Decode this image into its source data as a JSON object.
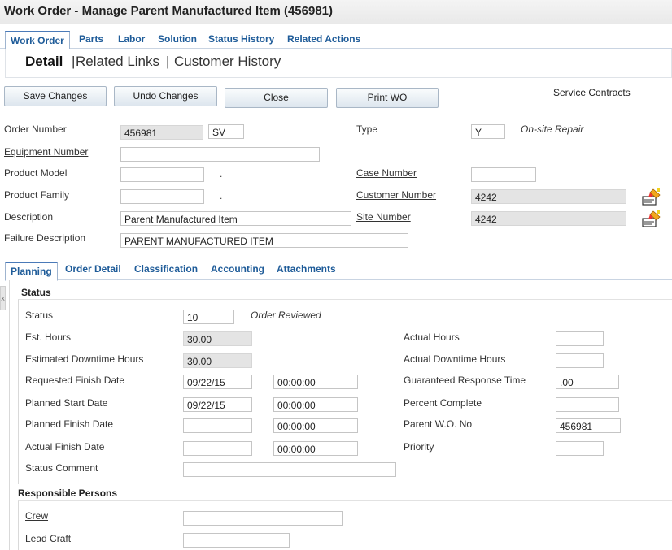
{
  "window": {
    "title": "Work Order - Manage Parent Manufactured Item (456981)"
  },
  "tabs": [
    "Work Order",
    "Parts",
    "Labor",
    "Solution",
    "Status History",
    "Related Actions"
  ],
  "subnav": {
    "detail": "Detail",
    "sep": "|",
    "related_links": "Related Links",
    "customer_history": "Customer History"
  },
  "toolbar": {
    "save": "Save Changes",
    "undo": "Undo Changes",
    "close": "Close",
    "print": "Print WO",
    "service_contracts": "Service Contracts"
  },
  "header": {
    "order_number": {
      "label": "Order Number",
      "value": "456981",
      "type_code": "SV"
    },
    "type": {
      "label": "Type",
      "value": "Y",
      "desc": "On-site Repair"
    },
    "equipment_number": {
      "label": "Equipment Number",
      "value": ""
    },
    "product_model": {
      "label": "Product Model",
      "value": "",
      "dot": "."
    },
    "case_number": {
      "label": "Case Number",
      "value": ""
    },
    "product_family": {
      "label": "Product Family",
      "value": "",
      "dot": "."
    },
    "customer_number": {
      "label": "Customer Number",
      "value": "4242"
    },
    "description": {
      "label": "Description",
      "value": "Parent Manufactured Item"
    },
    "site_number": {
      "label": "Site Number",
      "value": "4242"
    },
    "failure_description": {
      "label": "Failure Description",
      "value": "PARENT MANUFACTURED ITEM"
    }
  },
  "detail_tabs": [
    "Planning",
    "Order Detail",
    "Classification",
    "Accounting",
    "Attachments"
  ],
  "side_handle": "x",
  "status_section": {
    "title": "Status",
    "status": {
      "label": "Status",
      "value": "10",
      "desc": "Order Reviewed"
    },
    "est_hours": {
      "label": "Est. Hours",
      "value": "30.00"
    },
    "actual_hours": {
      "label": "Actual Hours",
      "value": ""
    },
    "est_downtime": {
      "label": "Estimated Downtime Hours",
      "value": "30.00"
    },
    "actual_downtime": {
      "label": "Actual Downtime Hours",
      "value": ""
    },
    "requested_finish": {
      "label": "Requested Finish Date",
      "date": "09/22/15",
      "time": "00:00:00"
    },
    "guaranteed_response": {
      "label": "Guaranteed Response Time",
      "value": ".00"
    },
    "planned_start": {
      "label": "Planned Start Date",
      "date": "09/22/15",
      "time": "00:00:00"
    },
    "percent_complete": {
      "label": "Percent Complete",
      "value": ""
    },
    "planned_finish": {
      "label": "Planned Finish Date",
      "date": "",
      "time": "00:00:00"
    },
    "parent_wo": {
      "label": "Parent W.O. No",
      "value": "456981"
    },
    "actual_finish": {
      "label": "Actual Finish Date",
      "date": "",
      "time": "00:00:00"
    },
    "priority": {
      "label": "Priority",
      "value": ""
    },
    "status_comment": {
      "label": "Status Comment",
      "value": ""
    }
  },
  "responsible": {
    "title": "Responsible Persons",
    "crew": {
      "label": "Crew",
      "value": ""
    },
    "lead_craft": {
      "label": "Lead Craft",
      "value": ""
    }
  }
}
